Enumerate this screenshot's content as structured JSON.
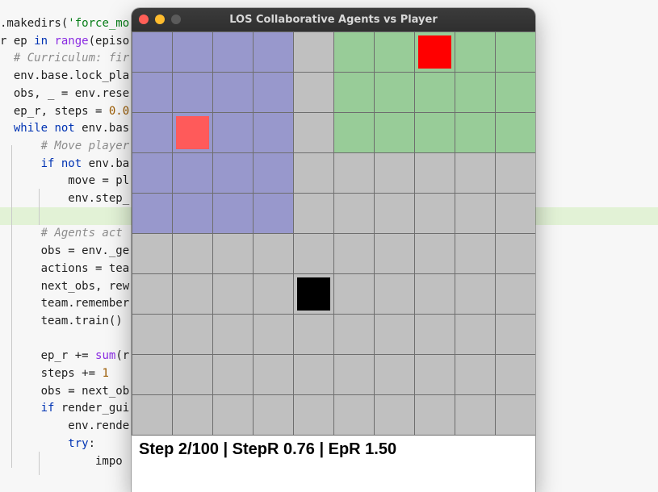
{
  "window": {
    "title": "LOS Collaborative Agents vs Player"
  },
  "status_text": "Step 2/100 | StepR 0.76 | EpR 1.50",
  "grid": {
    "size": 10,
    "zones": [
      {
        "name": "blue-zone",
        "color": "#9898cc",
        "cols": [
          0,
          3
        ],
        "rows": [
          0,
          4
        ]
      },
      {
        "name": "green-zone",
        "color": "#98cc98",
        "cols": [
          5,
          9
        ],
        "rows": [
          0,
          2
        ]
      }
    ],
    "default_color": "#c0c0c0",
    "entities": [
      {
        "name": "player-target",
        "color": "#ff0000",
        "col": 7,
        "row": 0
      },
      {
        "name": "agent-light-red",
        "color": "#ff5a5a",
        "col": 1,
        "row": 2
      },
      {
        "name": "player-black",
        "color": "#000000",
        "col": 4,
        "row": 6
      }
    ]
  },
  "code": {
    "lines": [
      {
        "text": ".makedirs('force_mo"
      },
      {
        "text": "r ep in range(episo"
      },
      {
        "text": "  # Curriculum: fir"
      },
      {
        "text": "  env.base.lock_pla"
      },
      {
        "text": "  obs, _ = env.rese"
      },
      {
        "text": "  ep_r, steps = 0.0"
      },
      {
        "text": "  while not env.bas"
      },
      {
        "text": "      # Move player"
      },
      {
        "text": "      if not env.ba"
      },
      {
        "text": "          move = pl"
      },
      {
        "text": "          env.step_"
      },
      {
        "text": ""
      },
      {
        "text": "      # Agents act "
      },
      {
        "text": "      obs = env._ge"
      },
      {
        "text": "      actions = tea"
      },
      {
        "text": "      next_obs, rew"
      },
      {
        "text": "      team.remember"
      },
      {
        "text": "      team.train()"
      },
      {
        "text": ""
      },
      {
        "text": "      ep_r += sum(r"
      },
      {
        "text": "      steps += 1"
      },
      {
        "text": "      obs = next_ob"
      },
      {
        "text": "      if render_gui"
      },
      {
        "text": "          env.rende"
      },
      {
        "text": "          try:"
      },
      {
        "text": "              impo"
      }
    ]
  }
}
